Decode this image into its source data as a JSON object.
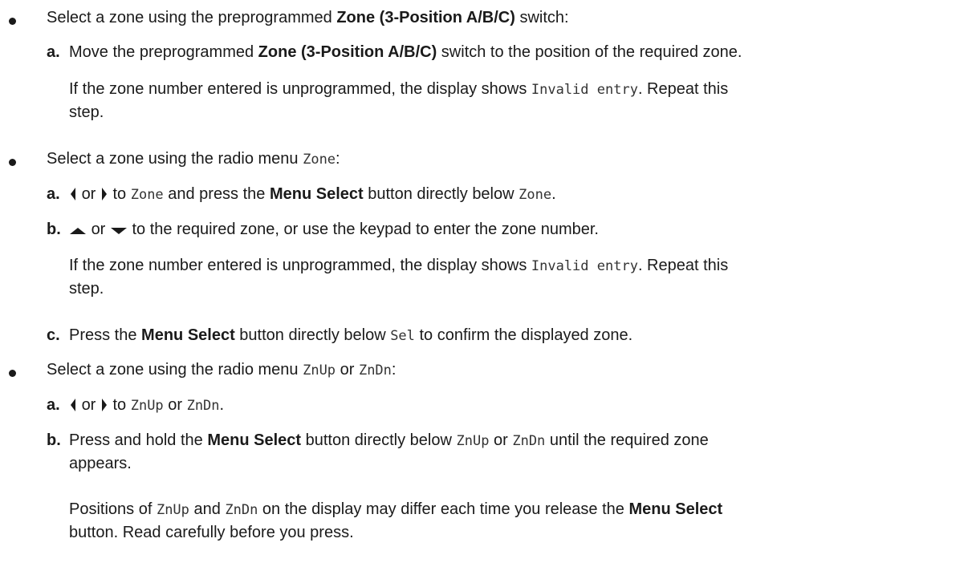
{
  "bullet1": {
    "pre": "Select a zone using the preprogrammed ",
    "bold": "Zone (3-Position A/B/C)",
    "post": " switch:",
    "step_a": {
      "letter": "a.",
      "pre": "Move the preprogrammed ",
      "bold": "Zone (3-Position A/B/C)",
      "post": " switch to the position of the required zone."
    },
    "note": {
      "pre": "If the zone number entered is unprogrammed, the display shows ",
      "code": "Invalid entry",
      "post": ". Repeat this",
      "cont": "step."
    }
  },
  "bullet2": {
    "pre": "Select a zone using the radio menu ",
    "code": "Zone",
    "post": ":",
    "step_a": {
      "letter": "a.",
      "or": "or",
      "to": " to ",
      "code1": "Zone",
      "mid": " and press the ",
      "bold": "Menu Select",
      "mid2": " button directly below ",
      "code2": "Zone",
      "end": "."
    },
    "step_b": {
      "letter": "b.",
      "or": "or",
      "text": " to the required zone, or use the keypad to enter the zone number."
    },
    "note": {
      "pre": "If the zone number entered is unprogrammed, the display shows ",
      "code": "Invalid entry",
      "post": ". Repeat this",
      "cont": "step."
    },
    "step_c": {
      "letter": "c.",
      "pre": "Press the ",
      "bold": "Menu Select",
      "mid": " button directly below ",
      "code": "Sel",
      "post": " to confirm the displayed zone."
    }
  },
  "bullet3": {
    "pre": "Select a zone using the radio menu ",
    "code1": "ZnUp",
    "or": " or ",
    "code2": "ZnDn",
    "post": ":",
    "step_a": {
      "letter": "a.",
      "or": "or",
      "to": " to ",
      "code1": "ZnUp",
      "or2": " or ",
      "code2": "ZnDn",
      "end": "."
    },
    "step_b": {
      "letter": "b.",
      "pre": "Press and hold the ",
      "bold": "Menu Select",
      "mid": " button directly below ",
      "code1": "ZnUp",
      "or": " or ",
      "code2": "ZnDn",
      "post": " until the required zone",
      "cont": "appears."
    },
    "note": {
      "pre": "Positions of ",
      "code1": "ZnUp",
      "and": " and ",
      "code2": "ZnDn",
      "mid": " on the display may differ each time you release the ",
      "bold": "Menu Select",
      "cont_pre": "button. Read carefully before you press."
    }
  },
  "icons": {
    "left": "left-arrow-icon",
    "right": "right-arrow-icon",
    "up": "up-arrow-icon",
    "down": "down-arrow-icon"
  }
}
